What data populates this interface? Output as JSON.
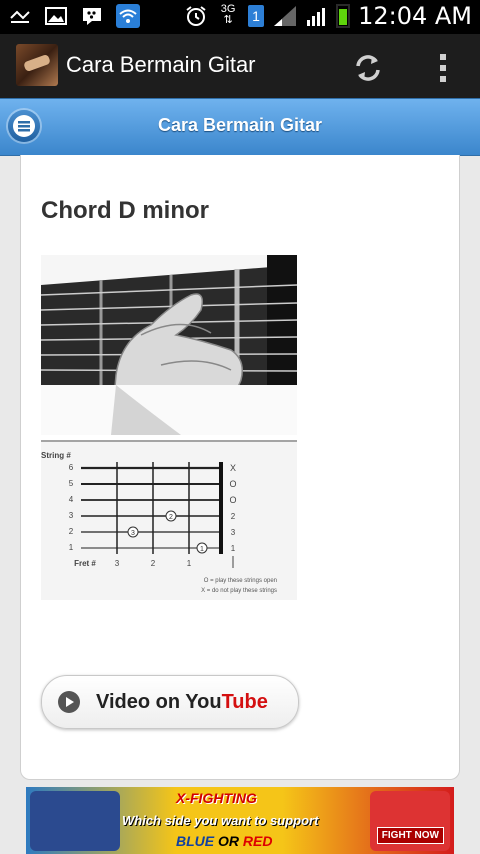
{
  "status_bar": {
    "time": "12:04 AM",
    "network": "3G",
    "sim_badge": "1",
    "icons_left": [
      "missed-call-icon",
      "image-icon",
      "bbm-icon",
      "wifi-icon"
    ],
    "icons_right": [
      "alarm-icon",
      "network-3g-icon",
      "sim-badge",
      "signal-icon",
      "signal-icon",
      "battery-icon"
    ]
  },
  "action_bar": {
    "title": "Cara Bermain Gitar",
    "buttons": [
      "refresh-icon",
      "overflow-menu-icon"
    ]
  },
  "page_header": {
    "title": "Cara Bermain Gitar"
  },
  "content": {
    "heading": "Chord D minor",
    "diagram": {
      "string_label": "String #",
      "strings": [
        "6",
        "5",
        "4",
        "3",
        "2",
        "1"
      ],
      "right_marks": [
        "X",
        "O",
        "O",
        "2",
        "3",
        "1"
      ],
      "fret_label": "Fret #",
      "frets": [
        "3",
        "2",
        "1"
      ],
      "fingers": [
        {
          "string": "3",
          "fret": "2",
          "finger": "2"
        },
        {
          "string": "2",
          "fret": "3",
          "finger": "3"
        },
        {
          "string": "1",
          "fret": "1",
          "finger": "1"
        }
      ],
      "legend_o": "O = play these strings open",
      "legend_x": "X = do not play these strings"
    },
    "youtube_button": {
      "label_prefix": "Video on You",
      "label_suffix": "Tube"
    }
  },
  "ad": {
    "brand": "X-FIGHTING",
    "tagline": "Which side you want to support",
    "choice_blue": "BLUE",
    "choice_or": " OR ",
    "choice_red": "RED",
    "cta": "FIGHT NOW"
  }
}
